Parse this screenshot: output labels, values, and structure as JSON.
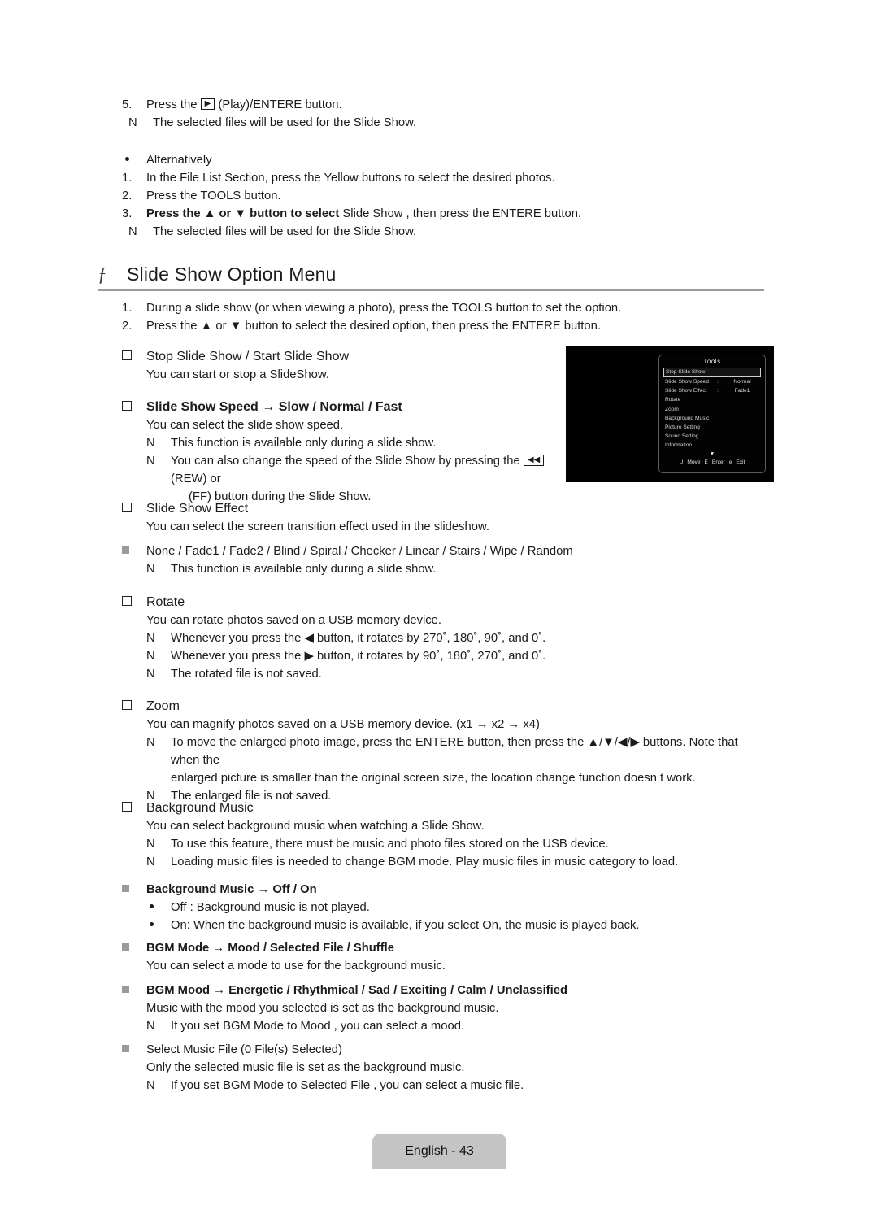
{
  "document": {
    "footer_label": "English - 43"
  },
  "top_steps": [
    {
      "marker": "5.",
      "text_pre": "Press the ",
      "icon": "play-icon",
      "text_post": " (Play)/ENTERE    button."
    },
    {
      "marker": "N",
      "text": "The selected files will be used for the Slide Show."
    }
  ],
  "alternatively": {
    "heading": "Alternatively",
    "steps": [
      {
        "marker": "1.",
        "text": "In the File List Section, press the Yellow buttons to select the desired photos."
      },
      {
        "marker": "2.",
        "text": "Press the TOOLS button."
      },
      {
        "marker": "3.",
        "bold_part": "Press the ▲ or ▼ button to select ",
        "normal_part": "Slide Show , then press the ENTERE    button."
      },
      {
        "marker": "N",
        "text": "The selected files will be used for the Slide Show."
      }
    ]
  },
  "section": {
    "glyph": "ƒ",
    "title": "Slide Show Option Menu",
    "intro": [
      {
        "marker": "1.",
        "text": "During a slide show (or when viewing a photo), press the TOOLS button to set the option."
      },
      {
        "marker": "2.",
        "text": "Press the ▲ or ▼ button to select the desired option, then press the ENTERE    button."
      }
    ]
  },
  "options": [
    {
      "title": "Stop Slide Show / Start Slide Show",
      "bold_title": false,
      "body": "You can start or stop a SlideShow.",
      "notes": []
    },
    {
      "title": "Slide Show Speed → Slow / Normal / Fast",
      "bold_title": true,
      "body": "You can select the slide show speed.",
      "notes": [
        "This function is available only during a slide show.",
        "You can also change the speed of the Slide Show by pressing the "
      ],
      "note_icon": "rew-icon",
      "note_tail": " (REW) or",
      "note_cont": "(FF) button during the Slide Show."
    },
    {
      "title": "Slide Show Effect",
      "bold_title": false,
      "body": "You can select the screen transition effect used in the slideshow.",
      "sub_square": "None / Fade1 / Fade2 / Blind / Spiral / Checker / Linear / Stairs / Wipe / Random",
      "notes": [
        "This function is available only during a slide show."
      ]
    },
    {
      "title": "Rotate",
      "bold_title": false,
      "body": "You can rotate photos saved on a USB memory device.",
      "notes": [
        "Whenever you press the ◀ button, it rotates by 270˚, 180˚, 90˚, and 0˚.",
        "Whenever you press the ▶ button, it rotates by 90˚, 180˚, 270˚, and 0˚.",
        "The rotated file is not saved."
      ]
    },
    {
      "title": "Zoom",
      "bold_title": false,
      "body": "You can magnify photos saved on a USB memory device. (x1 → x2 → x4)",
      "notes": [
        "To move the enlarged photo image, press the ENTERE    button, then press the ▲/▼/◀/▶ buttons. Note that when the",
        "The enlarged file is not saved."
      ],
      "note_wrap": "enlarged picture is smaller than the original screen size, the location change function doesn t work."
    },
    {
      "title": "Background Music",
      "bold_title": false,
      "body": "You can select background music when watching a Slide Show.",
      "notes": [
        "To use this feature, there must be music and photo files stored on the USB device.",
        "Loading music files is needed to change BGM mode. Play music files in music category to load."
      ]
    }
  ],
  "bgm_blocks": [
    {
      "square_title": "Background Music → Off / On",
      "bold": true,
      "dots": [
        "Off : Background music is not played.",
        "On: When the background music is available, if you select On, the music is played back."
      ]
    },
    {
      "square_title": "BGM Mode → Mood / Selected File / Shuffle",
      "bold": true,
      "body": "You can select a mode to use for the background music.",
      "dots": []
    },
    {
      "square_title": "BGM Mood → Energetic / Rhythmical / Sad / Exciting / Calm / Unclassified",
      "bold": true,
      "body": "Music with the mood you selected is set as the background music.",
      "notes": [
        "If you set BGM Mode  to Mood , you can select a mood."
      ],
      "dots": []
    },
    {
      "square_title": "Select Music File (0 File(s) Selected)",
      "bold": false,
      "body": "Only the selected music file is set as the background music.",
      "notes": [
        "If you set BGM Mode  to Selected File , you can select a music file."
      ],
      "dots": []
    }
  ],
  "osd": {
    "title": "Tools",
    "items": [
      {
        "label": "Stop Slide Show",
        "colon": "",
        "value": "",
        "selected": true
      },
      {
        "label": "Slide Show Speed",
        "colon": ":",
        "value": "Normal",
        "selected": false
      },
      {
        "label": "Slide Show Effect",
        "colon": ":",
        "value": "Fade1",
        "selected": false
      },
      {
        "label": "Rotate",
        "colon": "",
        "value": "",
        "selected": false
      },
      {
        "label": "Zoom",
        "colon": "",
        "value": "",
        "selected": false
      },
      {
        "label": "Background Music",
        "colon": "",
        "value": "",
        "selected": false
      },
      {
        "label": "Picture Setting",
        "colon": "",
        "value": "",
        "selected": false
      },
      {
        "label": "Sound Setting",
        "colon": "",
        "value": "",
        "selected": false
      },
      {
        "label": "Information",
        "colon": "",
        "value": "",
        "selected": false
      }
    ],
    "more_arrow": "▼",
    "legend": [
      {
        "key": "U",
        "action": "Move"
      },
      {
        "key": "E",
        "action": "Enter"
      },
      {
        "key": "e",
        "action": "Exit"
      }
    ]
  }
}
